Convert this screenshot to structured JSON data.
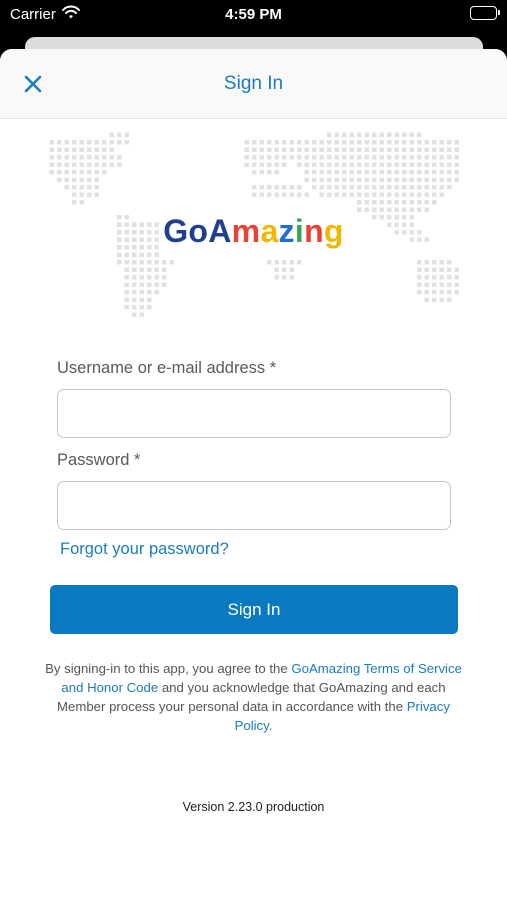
{
  "status_bar": {
    "carrier": "Carrier",
    "time": "4:59 PM"
  },
  "nav": {
    "title": "Sign In",
    "close_icon": "close-icon"
  },
  "logo": {
    "parts": [
      {
        "text": "GoA",
        "color": "#1f3f8f"
      },
      {
        "text": "m",
        "color": "#e94235"
      },
      {
        "text": "a",
        "color": "#f2b705"
      },
      {
        "text": "z",
        "color": "#1f6fd1"
      },
      {
        "text": "i",
        "color": "#34a853"
      },
      {
        "text": "n",
        "color": "#e94235"
      },
      {
        "text": "g",
        "color": "#f2b705"
      }
    ]
  },
  "form": {
    "username_label": "Username or e-mail address *",
    "username_value": "",
    "password_label": "Password *",
    "password_value": "",
    "forgot_link": "Forgot your password?",
    "submit_label": "Sign In"
  },
  "legal": {
    "text_1": "By signing-in to this app, you agree to the ",
    "terms_link": "GoAmazing Terms of Service and Honor Code",
    "text_2": " and you acknowledge that GoAmazing and each Member process your personal data in accordance with the ",
    "privacy_link": "Privacy Policy",
    "text_3": "."
  },
  "version": "Version 2.23.0 production",
  "colors": {
    "accent": "#1a7bbf",
    "button": "#0b79bf",
    "map_dots": "#e1e1e1"
  }
}
